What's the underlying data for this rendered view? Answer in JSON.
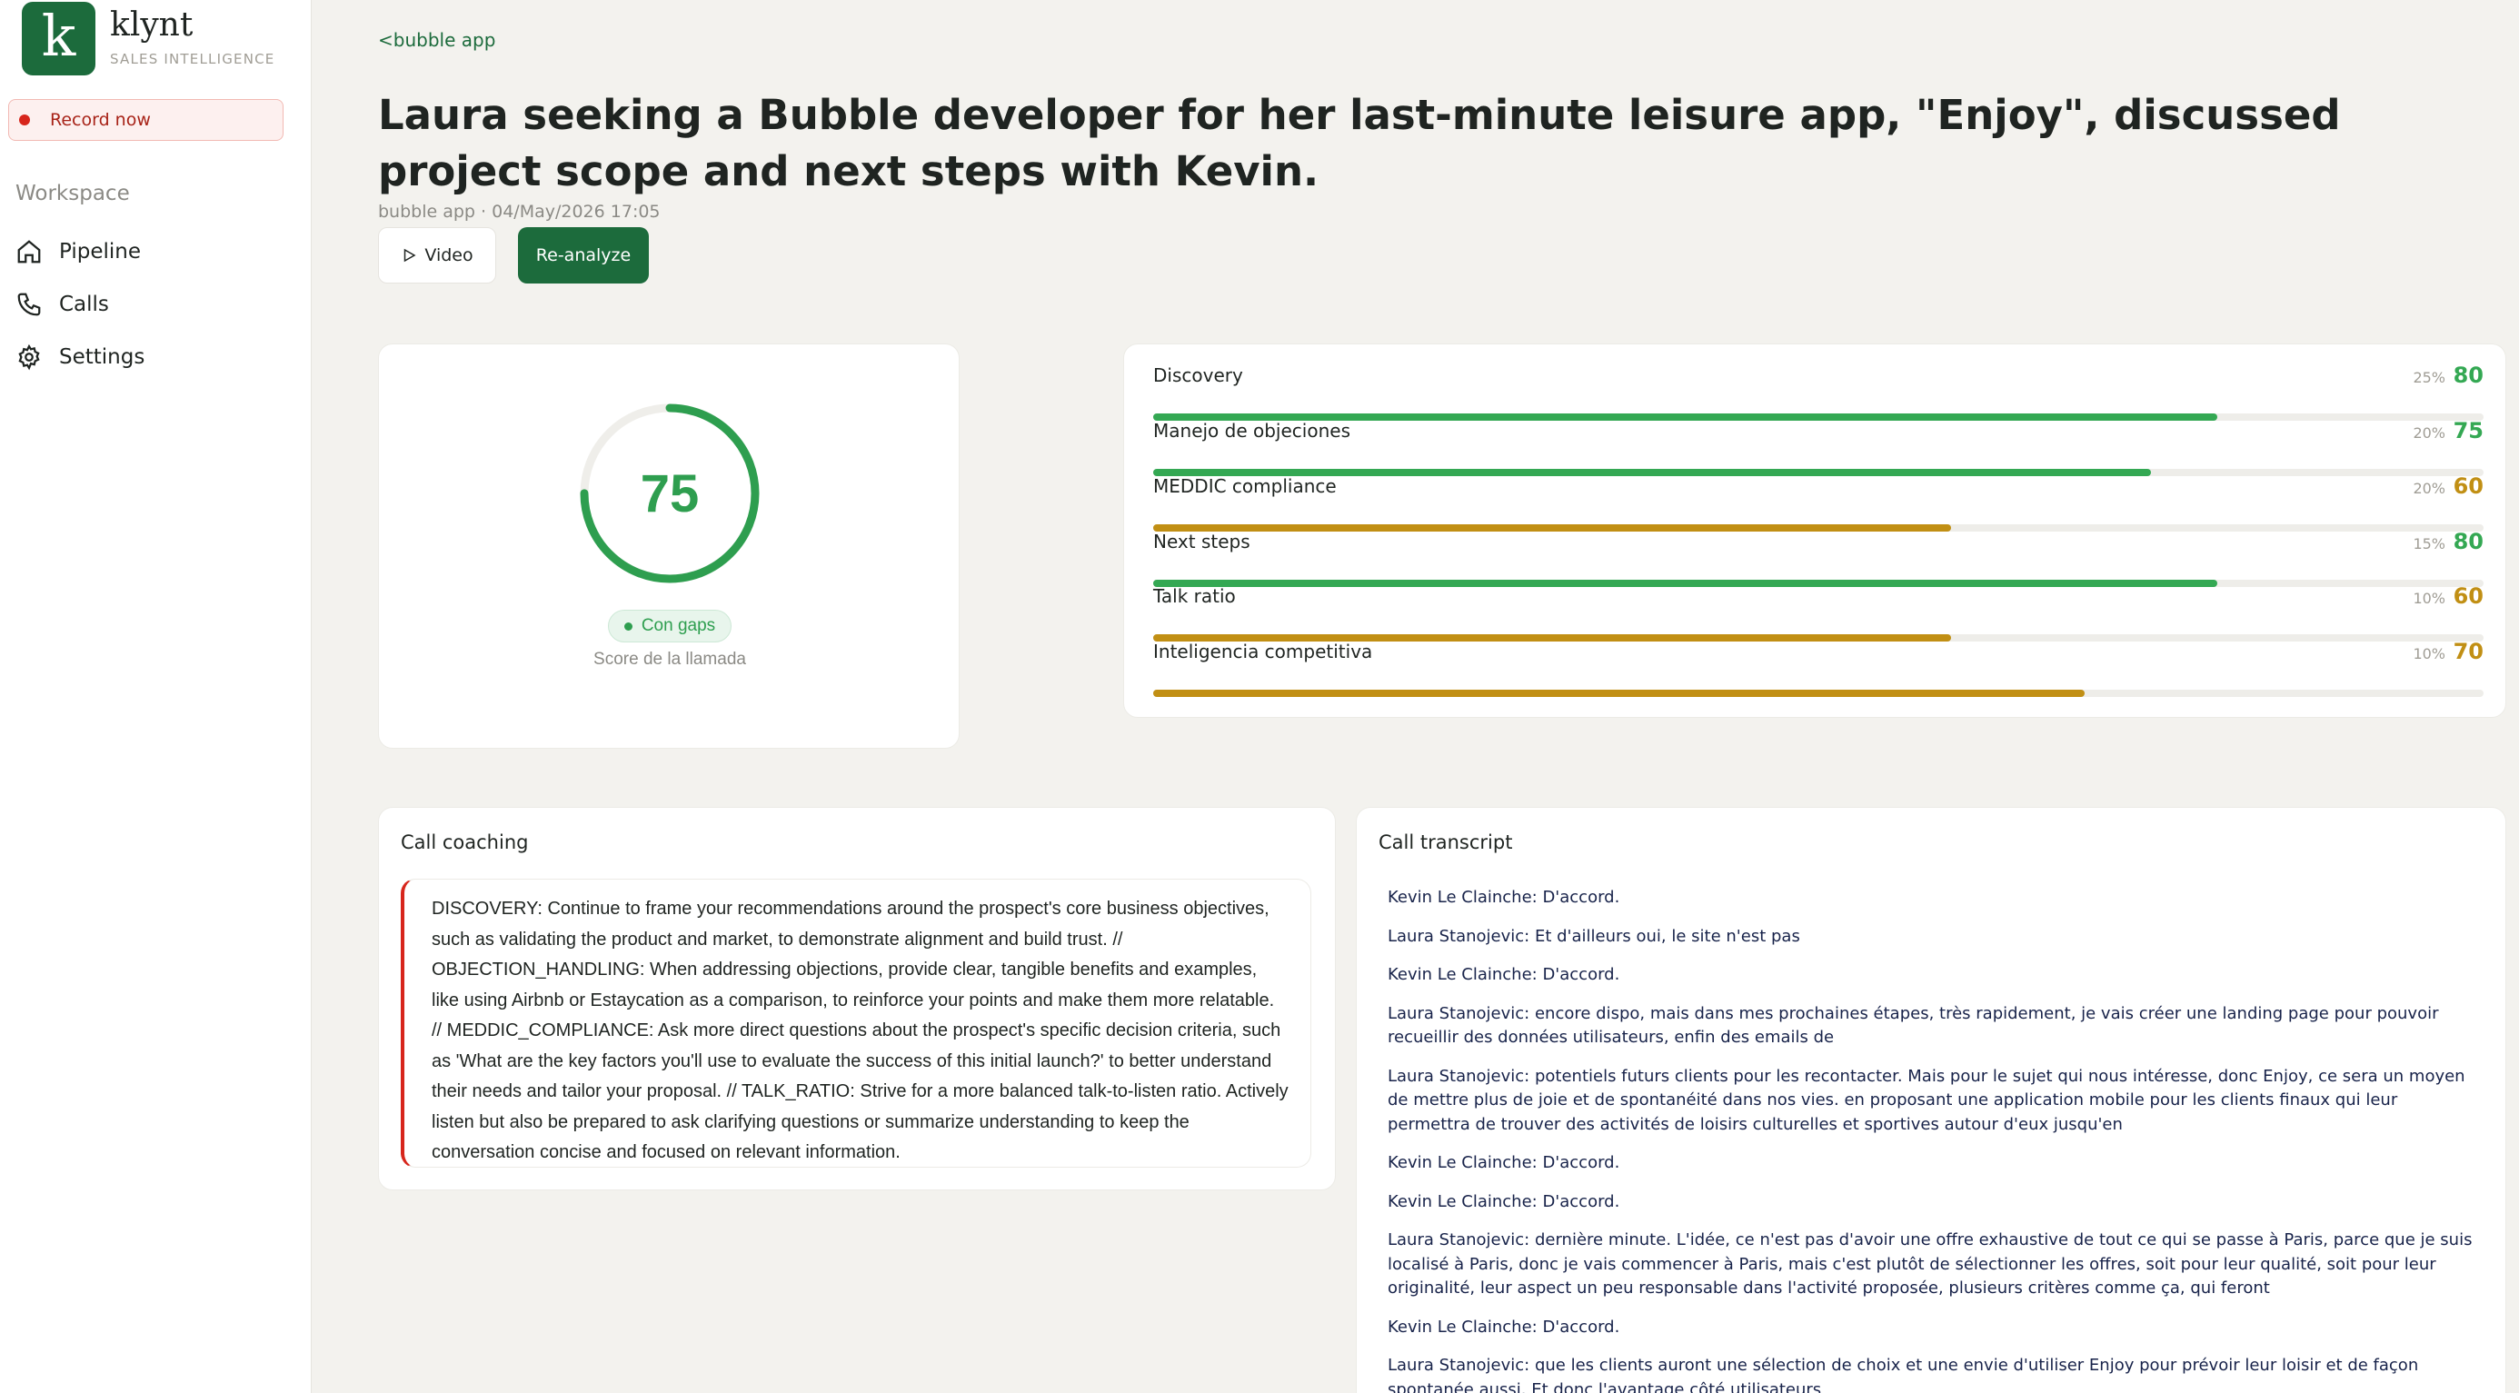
{
  "brand": {
    "logo_letter": "k",
    "name": "klynt",
    "subtitle": "SALES INTELLIGENCE",
    "color": "#1c6b3c"
  },
  "sidebar": {
    "record_label": "Record now",
    "section_title": "Workspace",
    "items": [
      {
        "label": "Pipeline",
        "icon": "home-icon"
      },
      {
        "label": "Calls",
        "icon": "phone-icon"
      },
      {
        "label": "Settings",
        "icon": "gear-icon"
      }
    ]
  },
  "header": {
    "back_label": "<bubble app",
    "title": "Laura seeking a Bubble developer for her last-minute leisure app, \"Enjoy\", discussed project scope and next steps with Kevin.",
    "meta": "bubble app · 04/May/2026 17:05",
    "video_label": "Video",
    "reanalyze_label": "Re-analyze"
  },
  "score": {
    "value": 75,
    "max": 100,
    "display": "75",
    "badge": "Con gaps",
    "caption": "Score de la llamada",
    "color": "#2e9e4f"
  },
  "metrics": [
    {
      "name": "Discovery",
      "weight": "25%",
      "score": 80,
      "color": "#34a853"
    },
    {
      "name": "Manejo de objeciones",
      "weight": "20%",
      "score": 75,
      "color": "#34a853"
    },
    {
      "name": "MEDDIC compliance",
      "weight": "20%",
      "score": 60,
      "color": "#c18f14"
    },
    {
      "name": "Next steps",
      "weight": "15%",
      "score": 80,
      "color": "#34a853"
    },
    {
      "name": "Talk ratio",
      "weight": "10%",
      "score": 60,
      "color": "#c18f14"
    },
    {
      "name": "Inteligencia competitiva",
      "weight": "10%",
      "score": 70,
      "color": "#c18f14"
    }
  ],
  "coaching": {
    "title": "Call coaching",
    "text": "DISCOVERY: Continue to frame your recommendations around the prospect's core business objectives, such as validating the product and market, to demonstrate alignment and build trust. // OBJECTION_HANDLING: When addressing objections, provide clear, tangible benefits and examples, like using Airbnb or Estaycation as a comparison, to reinforce your points and make them more relatable. // MEDDIC_COMPLIANCE: Ask more direct questions about the prospect's specific decision criteria, such as 'What are the key factors you'll use to evaluate the success of this initial launch?' to better understand their needs and tailor your proposal. // TALK_RATIO: Strive for a more balanced talk-to-listen ratio. Actively listen but also be prepared to ask clarifying questions or summarize understanding to keep the conversation concise and focused on relevant information."
  },
  "transcript": {
    "title": "Call transcript",
    "lines": [
      "Kevin Le Clainche: D'accord.",
      "Laura Stanojevic: Et d'ailleurs oui, le site n'est pas",
      "Kevin Le Clainche: D'accord.",
      "Laura Stanojevic: encore dispo, mais dans mes prochaines étapes, très rapidement, je vais créer une landing page pour pouvoir recueillir des données utilisateurs, enfin des emails de",
      "Laura Stanojevic: potentiels futurs clients pour les recontacter. Mais pour le sujet qui nous intéresse, donc Enjoy, ce sera un moyen de mettre plus de joie et de spontanéité dans nos vies. en proposant une application mobile pour les clients finaux qui leur permettra de trouver des activités de loisirs culturelles et sportives autour d'eux jusqu'en",
      "Kevin Le Clainche: D'accord.",
      "Kevin Le Clainche: D'accord.",
      "Laura Stanojevic: dernière minute. L'idée, ce n'est pas d'avoir une offre exhaustive de tout ce qui se passe à Paris, parce que je suis localisé à Paris, donc je vais commencer à Paris, mais c'est plutôt de sélectionner les offres, soit pour leur qualité, soit pour leur originalité, leur aspect un peu responsable dans l'activité proposée, plusieurs critères comme ça, qui feront",
      "Kevin Le Clainche: D'accord.",
      "Laura Stanojevic: que les clients auront une sélection de choix et une envie d'utiliser Enjoy pour prévoir leur loisir et de façon spontanée aussi. Et donc l'avantage côté utilisateurs"
    ]
  }
}
